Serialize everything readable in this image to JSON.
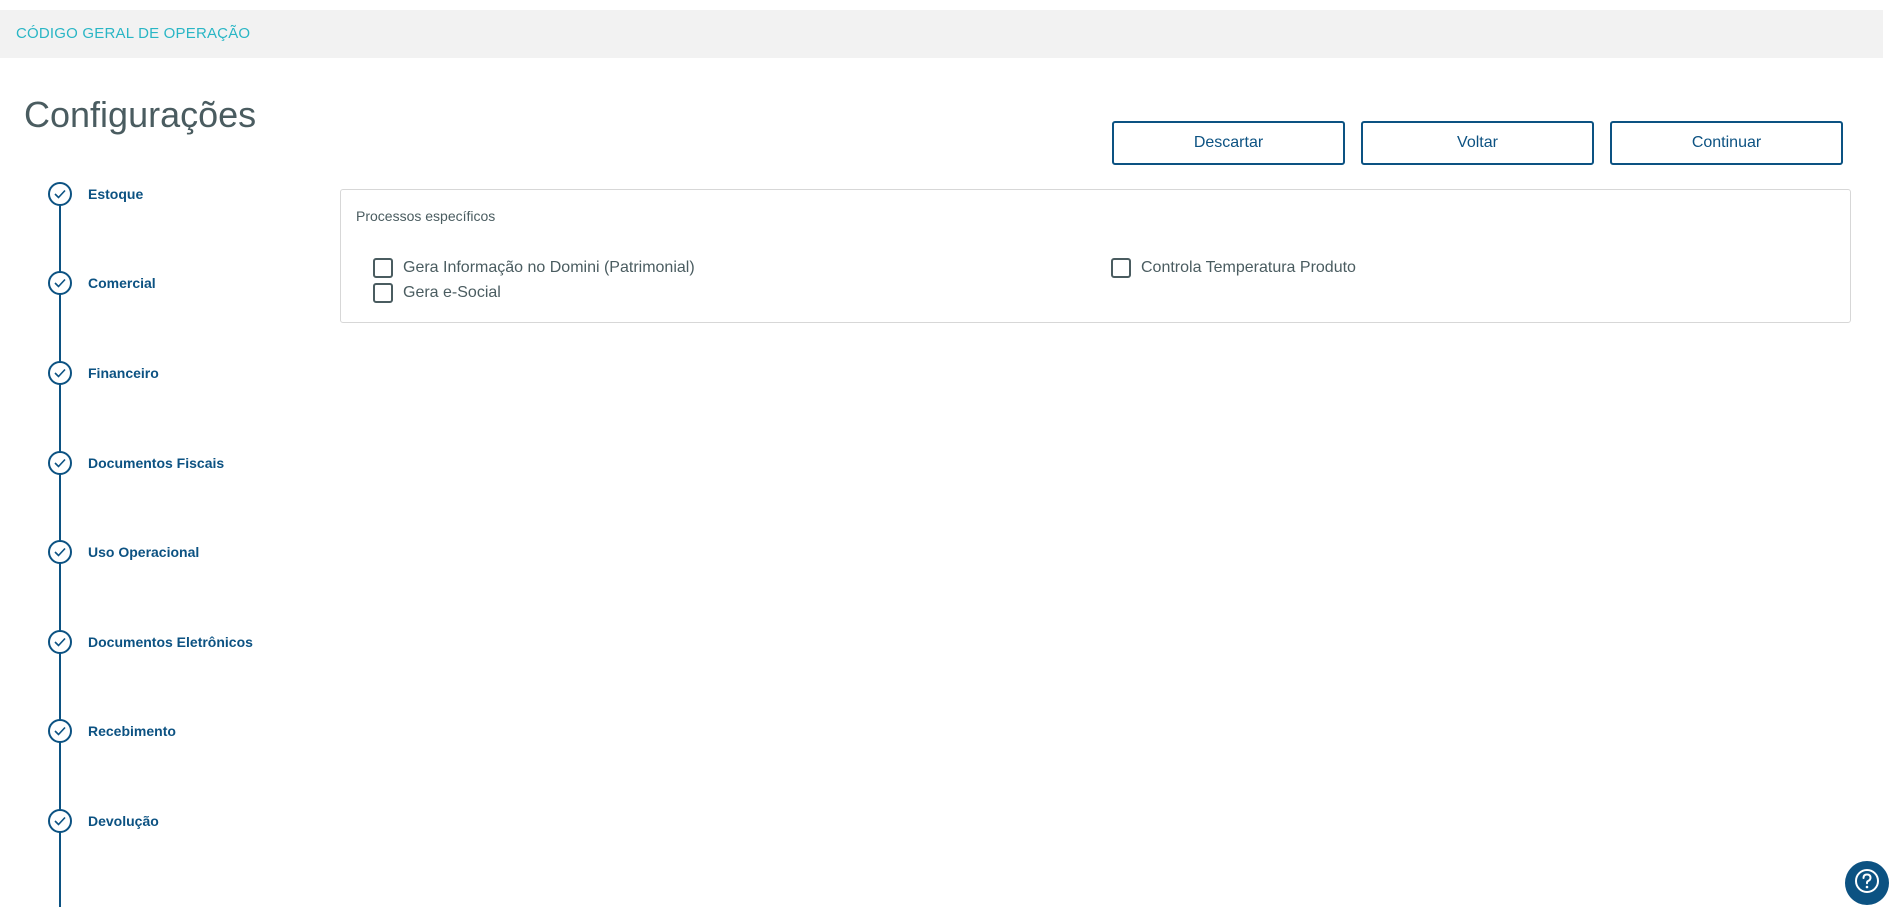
{
  "header": {
    "breadcrumb": "CÓDIGO GERAL DE OPERAÇÃO"
  },
  "page": {
    "title": "Configurações"
  },
  "actions": {
    "discard_label": "Descartar",
    "back_label": "Voltar",
    "continue_label": "Continuar"
  },
  "steps": [
    {
      "label": "Estoque",
      "status": "completed"
    },
    {
      "label": "Comercial",
      "status": "completed"
    },
    {
      "label": "Financeiro",
      "status": "completed"
    },
    {
      "label": "Documentos Fiscais",
      "status": "completed"
    },
    {
      "label": "Uso Operacional",
      "status": "completed"
    },
    {
      "label": "Documentos Eletrônicos",
      "status": "completed"
    },
    {
      "label": "Recebimento",
      "status": "completed"
    },
    {
      "label": "Devolução",
      "status": "completed"
    }
  ],
  "panel": {
    "title": "Processos específicos",
    "options": [
      {
        "label": "Gera Informação no Domini (Patrimonial)",
        "checked": false
      },
      {
        "label": "Gera e-Social",
        "checked": false
      },
      {
        "label": "Controla Temperatura Produto",
        "checked": false
      }
    ]
  },
  "icons": {
    "step": "check-circle-icon",
    "help": "help-icon"
  },
  "colors": {
    "primary": "#0c5282",
    "breadcrumb": "#29b6c5",
    "text": "#4a5c60",
    "header_bg": "#f2f2f2"
  }
}
